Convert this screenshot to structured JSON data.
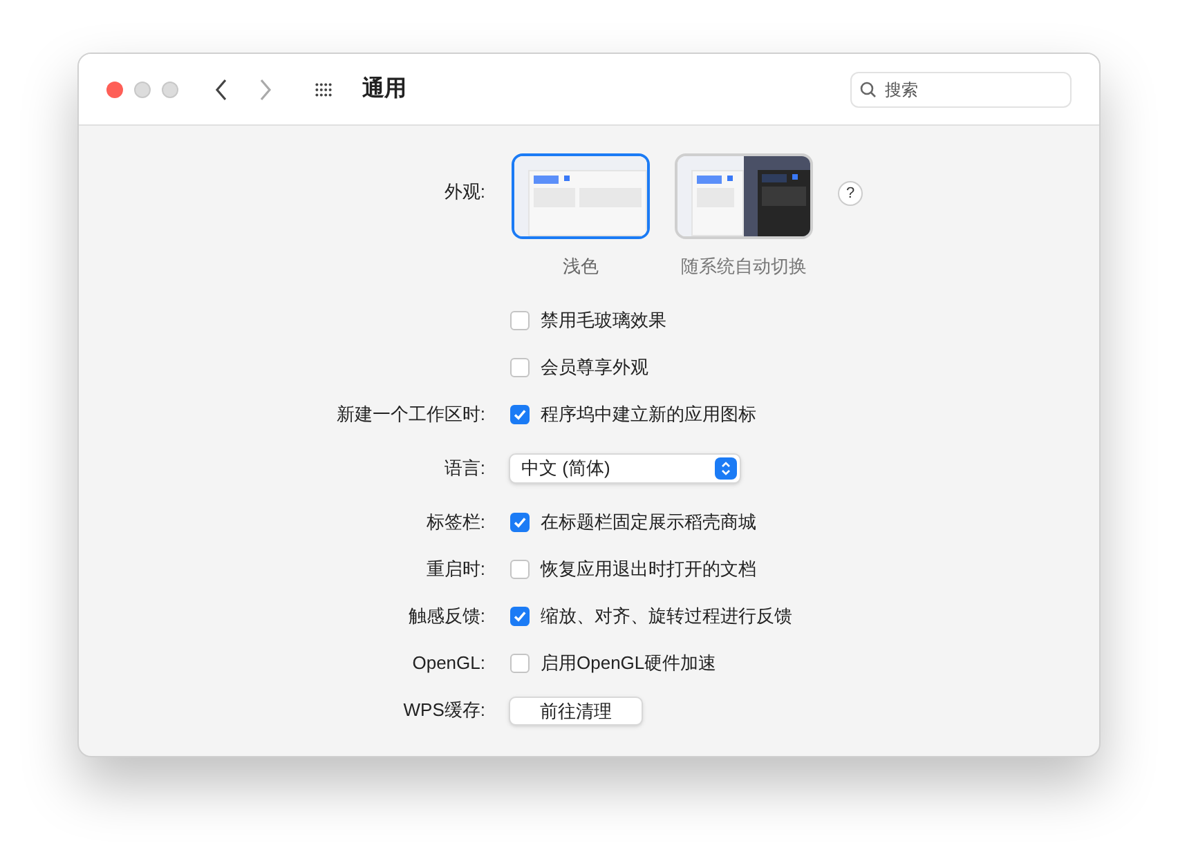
{
  "window": {
    "title": "通用"
  },
  "search": {
    "placeholder": "搜索"
  },
  "rows": [
    {
      "kind": "appearance",
      "label": "外观:",
      "options": [
        {
          "caption": "浅色",
          "kind": "light",
          "selected": true
        },
        {
          "caption": "随系统自动切换",
          "kind": "auto",
          "selected": false
        }
      ],
      "help": "?"
    },
    {
      "kind": "checkbox",
      "text": "禁用毛玻璃效果",
      "checked": false
    },
    {
      "kind": "checkbox",
      "text": "会员尊享外观",
      "checked": false
    },
    {
      "kind": "checkbox",
      "label": "新建一个工作区时:",
      "text": "程序坞中建立新的应用图标",
      "checked": true
    },
    {
      "kind": "select",
      "label": "语言:",
      "value": "中文 (简体)"
    },
    {
      "kind": "checkbox",
      "label": "标签栏:",
      "text": "在标题栏固定展示稻壳商城",
      "checked": true
    },
    {
      "kind": "checkbox",
      "label": "重启时:",
      "text": "恢复应用退出时打开的文档",
      "checked": false
    },
    {
      "kind": "checkbox",
      "label": "触感反馈:",
      "text": "缩放、对齐、旋转过程进行反馈",
      "checked": true
    },
    {
      "kind": "checkbox",
      "label": "OpenGL:",
      "text": "启用OpenGL硬件加速",
      "checked": false
    },
    {
      "kind": "button",
      "label": "WPS缓存:",
      "text": "前往清理"
    }
  ]
}
